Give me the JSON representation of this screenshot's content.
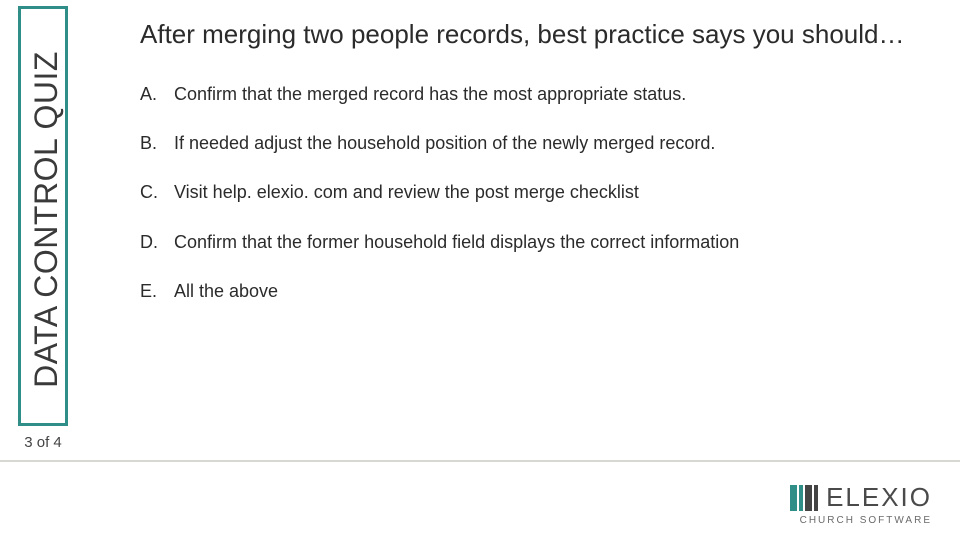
{
  "colors": {
    "accent": "#2f8f88",
    "text": "#2b2b2b",
    "divider": "#d8d8d2",
    "logo_text": "#4a4a4a",
    "logo_sub": "#6a6a6a"
  },
  "sidebar": {
    "title": "DATA CONTROL QUIZ"
  },
  "page": {
    "current": 3,
    "total": 4,
    "counter_text": "3 of 4"
  },
  "question": "After merging two people records, best practice says you should…",
  "options": [
    {
      "letter": "A.",
      "text": "Confirm that the merged record has the most appropriate status."
    },
    {
      "letter": "B.",
      "text": "If needed adjust the household position of the newly merged record."
    },
    {
      "letter": "C.",
      "text": "Visit help. elexio. com and review the post merge checklist"
    },
    {
      "letter": "D.",
      "text": "Confirm that the former household field displays the correct information"
    },
    {
      "letter": "E.",
      "text": "All the above"
    }
  ],
  "logo": {
    "name": "ELEXIO",
    "tagline": "CHURCH SOFTWARE"
  }
}
